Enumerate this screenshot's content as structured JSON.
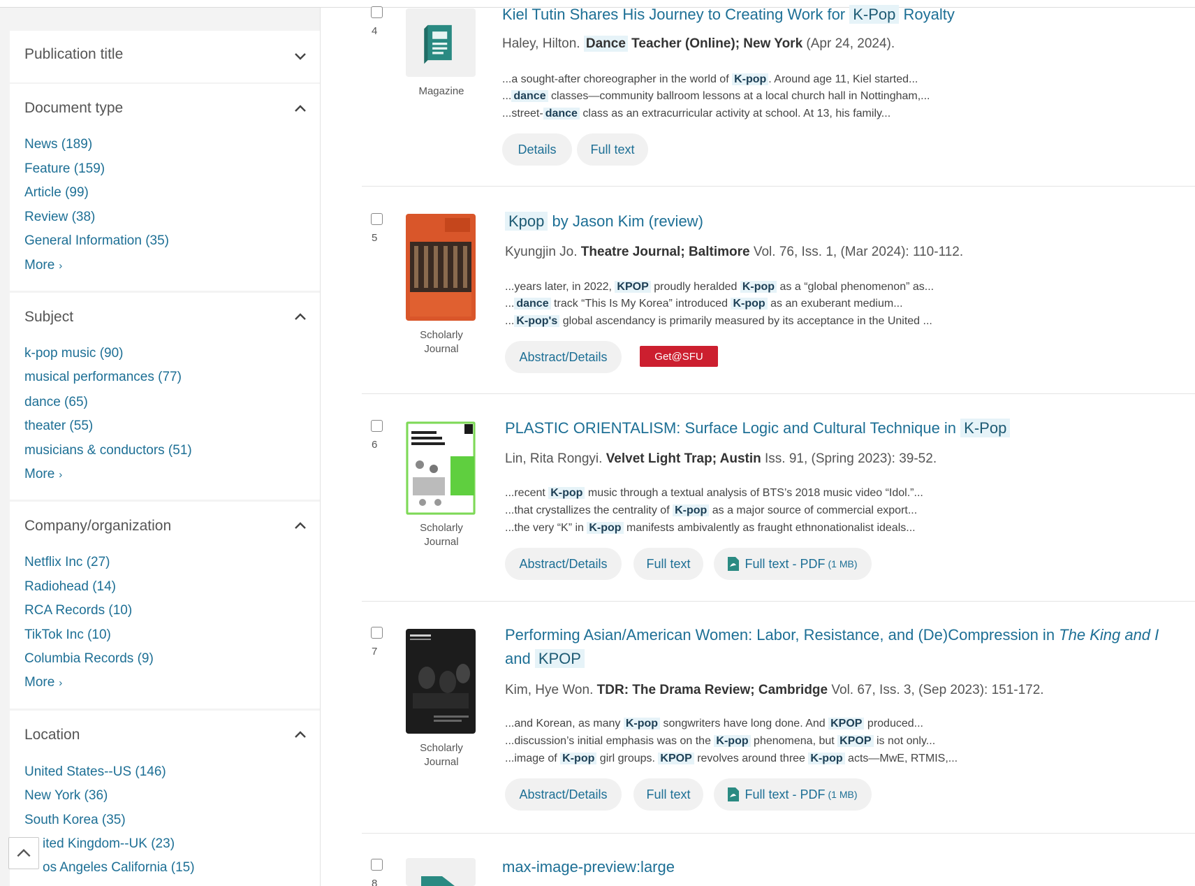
{
  "sidebar": {
    "publication_title": {
      "label": "Publication title"
    },
    "document_type": {
      "label": "Document type",
      "items": [
        "News (189)",
        "Feature (159)",
        "Article (99)",
        "Review (38)",
        "General Information (35)"
      ],
      "more": "More"
    },
    "subject": {
      "label": "Subject",
      "items": [
        "k-pop music (90)",
        "musical performances (77)",
        "dance (65)",
        "theater (55)",
        "musicians & conductors (51)"
      ],
      "more": "More"
    },
    "company": {
      "label": "Company/organization",
      "items": [
        "Netflix Inc (27)",
        "Radiohead (14)",
        "RCA Records (10)",
        "TikTok Inc (10)",
        "Columbia Records (9)"
      ],
      "more": "More"
    },
    "location": {
      "label": "Location",
      "items": [
        "United States--US (146)",
        "New York (36)",
        "South Korea (35)",
        "ited Kingdom--UK (23)",
        "os Angeles California (15)"
      ]
    }
  },
  "results": {
    "r4": {
      "number": "4",
      "type_label": "Magazine",
      "title_pre": "Kiel Tutin Shares His Journey to Creating Work for ",
      "title_hl": "K-Pop",
      "title_post": " Royalty",
      "author": "Haley, Hilton.",
      "pub_hl": "Dance",
      "pub_rest": " Teacher (Online); New York",
      "date": " (Apr 24, 2024).",
      "snippets": [
        [
          "...a sought-after choreographer in the world of ",
          "K-pop",
          ". Around age 11, Kiel started..."
        ],
        [
          "...",
          "dance",
          " classes—community ballroom lessons at a local church hall in Nottingham,..."
        ],
        [
          "...street-",
          "dance",
          " class as an extracurricular activity at school. At 13, his family..."
        ]
      ],
      "actions": [
        "Details",
        "Full text"
      ]
    },
    "r5": {
      "number": "5",
      "type_label": [
        "Scholarly",
        "Journal"
      ],
      "title_hl": "Kpop",
      "title_post": " by Jason Kim (review)",
      "author": "Kyungjin Jo.",
      "pub": "Theatre Journal; Baltimore",
      "details": " Vol. 76, Iss. 1,  (Mar 2024): 110-112.",
      "snippets": [
        [
          "...years later, in 2022, ",
          "KPOP",
          " proudly heralded ",
          "K-pop",
          " as a “global phenomenon” as..."
        ],
        [
          "...",
          "dance",
          " track “This Is My Korea” introduced ",
          "K-pop",
          " as an exuberant medium..."
        ],
        [
          "...",
          "K-pop's",
          " global ascendancy is primarily measured by its acceptance in the United ..."
        ]
      ],
      "actions": [
        "Abstract/Details"
      ],
      "getsfu": "Get@SFU"
    },
    "r6": {
      "number": "6",
      "type_label": [
        "Scholarly",
        "Journal"
      ],
      "title_pre": "PLASTIC ORIENTALISM: Surface Logic and Cultural Technique in ",
      "title_hl": "K-Pop",
      "author": "Lin, Rita Rongyi.",
      "pub": "Velvet Light Trap; Austin",
      "details": " Iss. 91,  (Spring 2023): 39-52.",
      "snippets": [
        [
          "...recent ",
          "K-pop",
          " music through a textual analysis of BTS’s 2018 music video “Idol.”..."
        ],
        [
          "...that crystallizes the centrality of ",
          "K-pop",
          " as a major source of commercial export..."
        ],
        [
          "...the very “K” in ",
          "K-pop",
          " manifests ambivalently as fraught ethnonationalist ideals..."
        ]
      ],
      "actions": [
        "Abstract/Details",
        "Full text"
      ],
      "pdf": {
        "label": "Full text - PDF",
        "size": "(1 MB)"
      }
    },
    "r7": {
      "number": "7",
      "type_label": [
        "Scholarly",
        "Journal"
      ],
      "title_pre": "Performing Asian/American Women: Labor, Resistance, and (De)Compression in ",
      "title_italic": "The King and I",
      "title_line2_pre": "and ",
      "title_hl": "KPOP",
      "author": "Kim, Hye Won.",
      "pub": "TDR: The Drama Review; Cambridge",
      "details": " Vol. 67, Iss. 3,  (Sep 2023): 151-172.",
      "snippets": [
        [
          "...and Korean, as many ",
          "K-pop",
          " songwriters have long done. And ",
          "KPOP",
          " produced..."
        ],
        [
          "...discussion’s initial emphasis was on the ",
          "K-pop",
          " phenomena, but ",
          "KPOP",
          " is not only..."
        ],
        [
          "...image of ",
          "K-pop",
          " girl groups. ",
          "KPOP",
          " revolves around three ",
          "K-pop",
          " acts—MwE, RTMIS,..."
        ]
      ],
      "actions": [
        "Abstract/Details",
        "Full text"
      ],
      "pdf": {
        "label": "Full text - PDF",
        "size": "(1 MB)"
      }
    },
    "r8": {
      "number": "8",
      "title": "max-image-preview:large"
    }
  },
  "colors": {
    "link": "#1d6f95",
    "highlight": "#e6f3f8",
    "getsfu": "#cc1f2f",
    "magazine_icon": "#2a8a82"
  },
  "icons": [
    "chevron-down-icon",
    "chevron-up-icon",
    "magazine-icon",
    "pdf-icon",
    "back-to-top-icon"
  ]
}
